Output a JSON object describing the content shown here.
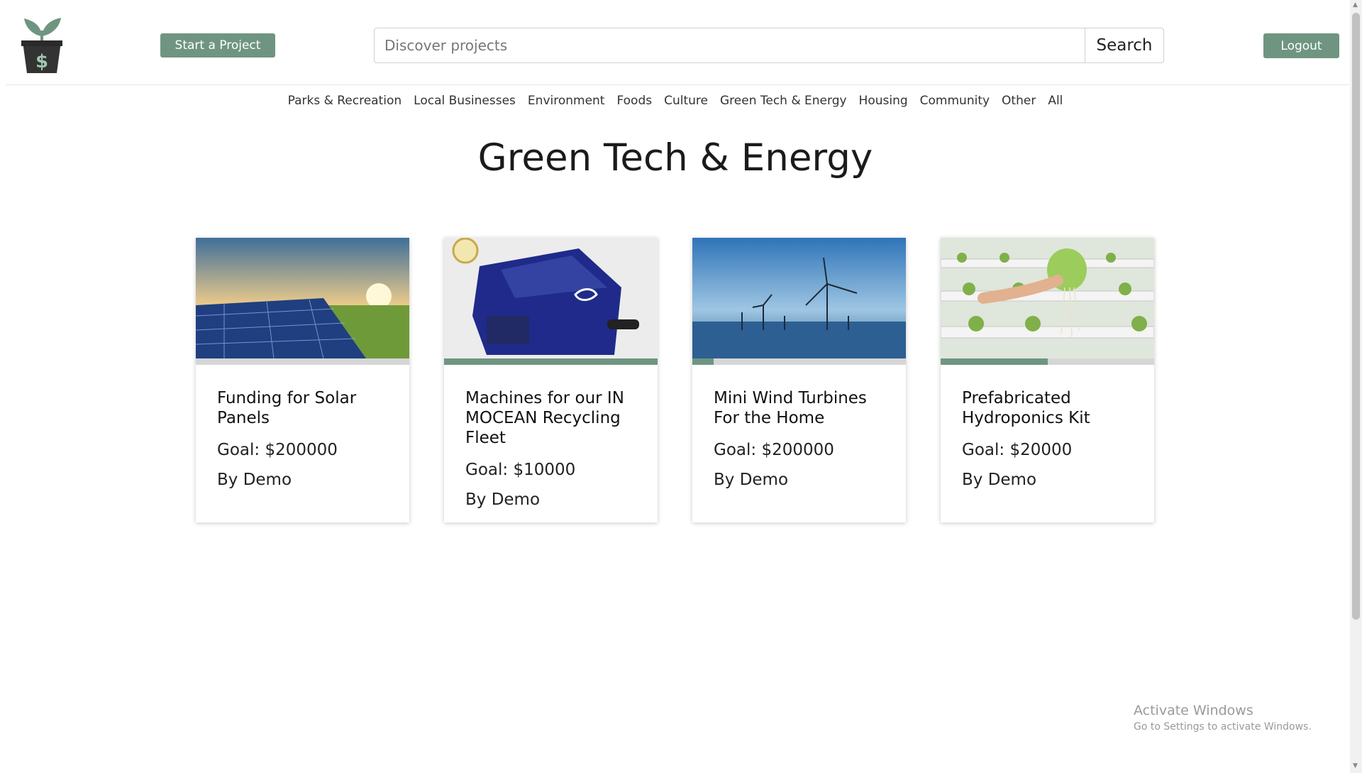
{
  "header": {
    "start_label": "Start a Project",
    "logout_label": "Logout",
    "search_placeholder": "Discover projects",
    "search_button": "Search",
    "logo_icon": "plant-pot-dollar-icon"
  },
  "categories": [
    "Parks & Recreation",
    "Local Businesses",
    "Environment",
    "Foods",
    "Culture",
    "Green Tech & Energy",
    "Housing",
    "Community",
    "Other",
    "All"
  ],
  "page_title": "Green Tech & Energy",
  "accent_color": "#6f9581",
  "projects": [
    {
      "title": "Funding for Solar Panels",
      "goal": "Goal: $200000",
      "author": "By Demo",
      "image": "solar-panels",
      "progress_fraction": 0.0
    },
    {
      "title": "Machines for our IN MOCEAN Recycling Fleet",
      "goal": "Goal: $10000",
      "author": "By Demo",
      "image": "recycling-machine",
      "progress_fraction": 1.0
    },
    {
      "title": "Mini Wind Turbines For the Home",
      "goal": "Goal: $200000",
      "author": "By Demo",
      "image": "wind-turbines",
      "progress_fraction": 0.1
    },
    {
      "title": "Prefabricated Hydroponics Kit",
      "goal": "Goal: $20000",
      "author": "By Demo",
      "image": "hydroponics",
      "progress_fraction": 0.5
    }
  ],
  "watermark": {
    "line1": "Activate Windows",
    "line2": "Go to Settings to activate Windows."
  }
}
